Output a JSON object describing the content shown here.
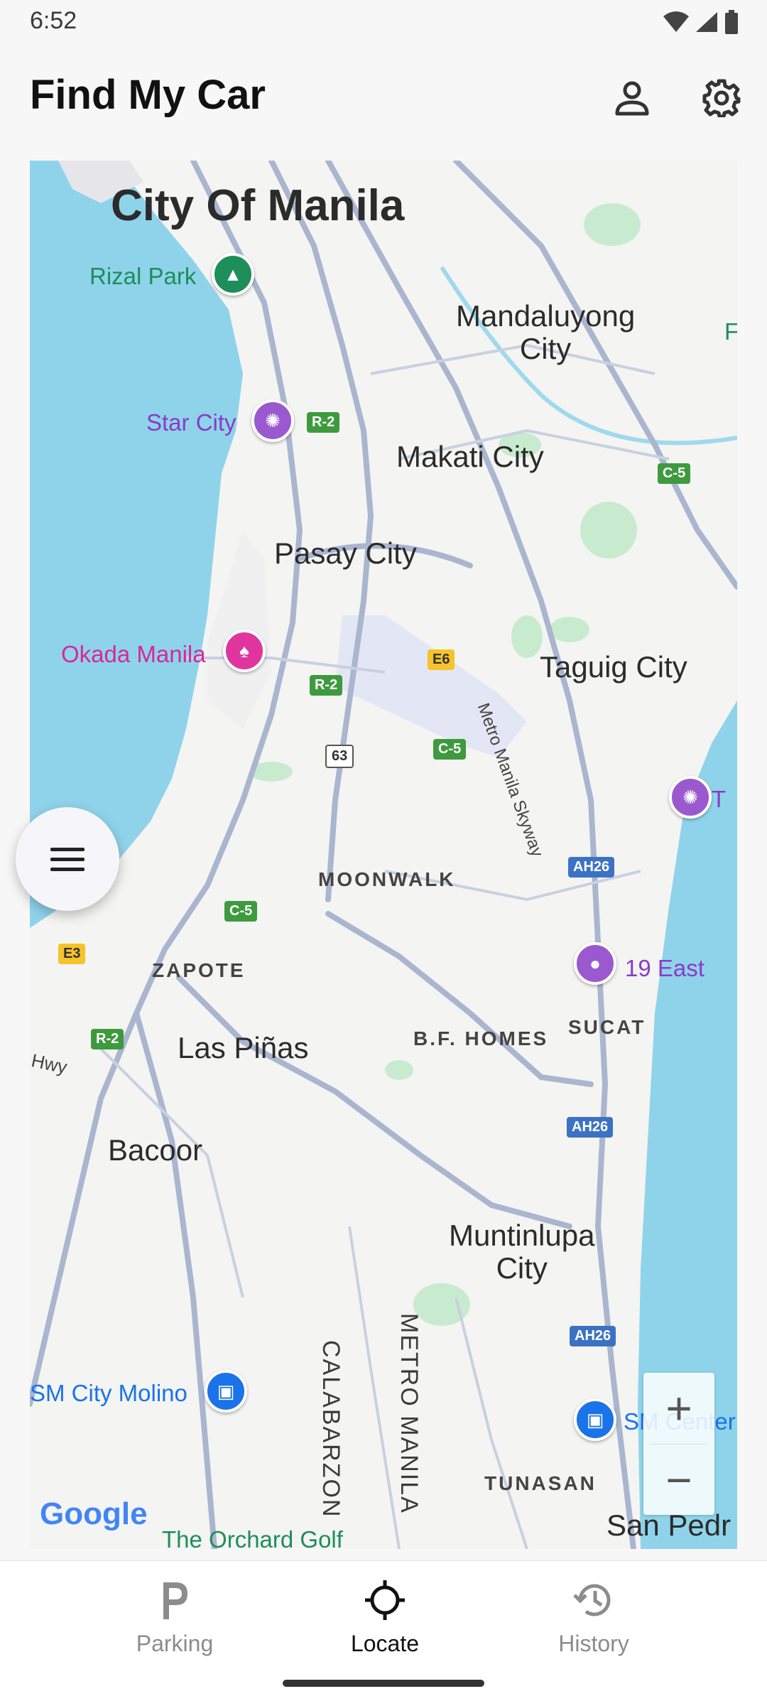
{
  "status_bar": {
    "time": "6:52",
    "icons": [
      "wifi-icon",
      "signal-icon",
      "battery-icon"
    ]
  },
  "header": {
    "title": "Find My Car",
    "profile_icon": "person-icon",
    "settings_icon": "gear-icon"
  },
  "map": {
    "cities": {
      "manila": "City Of Manila",
      "mandaluyong": "Mandaluyong\nCity",
      "makati": "Makati City",
      "pasay": "Pasay City",
      "taguig": "Taguig City",
      "las_pinas": "Las Piñas",
      "bacoor": "Bacoor",
      "muntinlupa": "Muntinlupa\nCity",
      "san_pedro": "San Pedr"
    },
    "districts": {
      "moonwalk": "MOONWALK",
      "zapote": "ZAPOTE",
      "bf_homes": "B.F. HOMES",
      "sucat": "SUCAT",
      "tunasan": "TUNASAN"
    },
    "pois": {
      "rizal_park": "Rizal Park",
      "star_city": "Star City",
      "okada_manila": "Okada Manila",
      "nineteen_east": "19 East",
      "sm_molino": "SM City Molino",
      "sm_center": "SM Center",
      "orchard_golf": "The Orchard Golf",
      "edge_t": "T",
      "edge_f": "F"
    },
    "roads": {
      "skyway": "Metro Manila Skyway",
      "calabarzon": "CALABARZON",
      "metro_manila": "METRO MANILA",
      "hwy": "Hwy"
    },
    "shields": {
      "r2_a": "R-2",
      "r2_b": "R-2",
      "r2_c": "R-2",
      "c5_a": "C-5",
      "c5_b": "C-5",
      "c5_c": "C-5",
      "e6": "E6",
      "r63": "63",
      "e3": "E3",
      "ah26_a": "AH26",
      "ah26_b": "AH26",
      "ah26_c": "AH26"
    },
    "attribution": "Google",
    "zoom_in": "+",
    "zoom_out": "−"
  },
  "bottom_nav": {
    "items": [
      {
        "label": "Parking",
        "icon": "parking-icon",
        "active": false
      },
      {
        "label": "Locate",
        "icon": "crosshair-icon",
        "active": true
      },
      {
        "label": "History",
        "icon": "history-icon",
        "active": false
      }
    ]
  }
}
